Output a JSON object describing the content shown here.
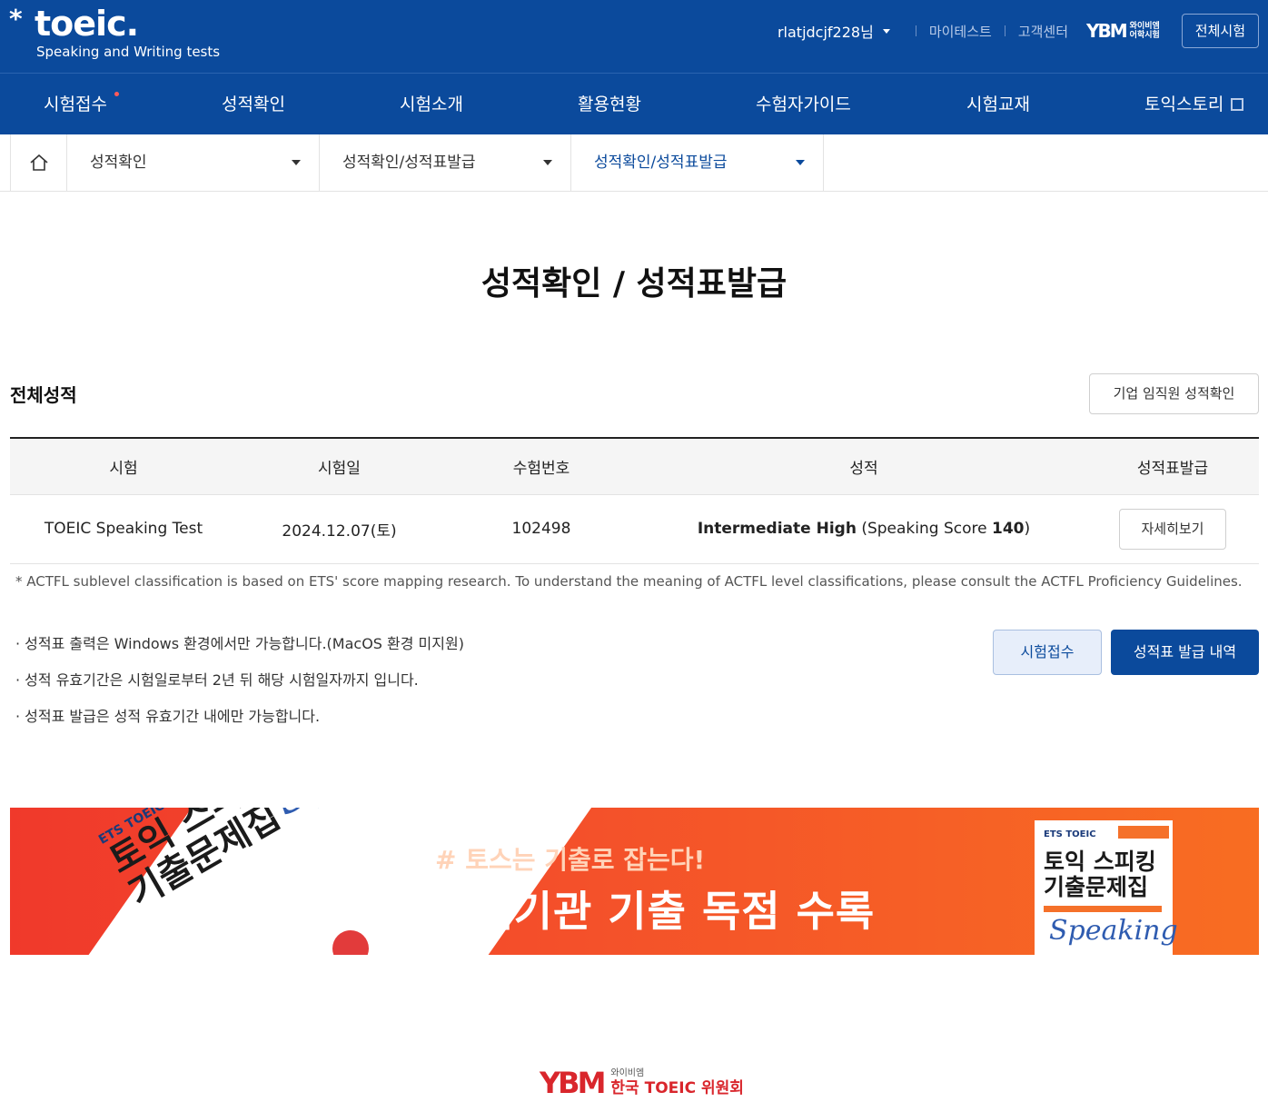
{
  "header": {
    "logo_main": "toeic.",
    "logo_sub": "Speaking and Writing tests",
    "user_name": "rlatjdcjf228님",
    "my_test": "마이테스트",
    "customer_center": "고객센터",
    "ybm_text_line1": "와이비엠",
    "ybm_text_line2": "어학시험",
    "all_tests": "전체시험"
  },
  "nav": {
    "items": [
      {
        "label": "시험접수"
      },
      {
        "label": "성적확인"
      },
      {
        "label": "시험소개"
      },
      {
        "label": "활용현황"
      },
      {
        "label": "수험자가이드"
      },
      {
        "label": "시험교재"
      },
      {
        "label": "토익스토리"
      }
    ]
  },
  "breadcrumb": {
    "level1": "성적확인",
    "level2": "성적확인/성적표발급",
    "level3": "성적확인/성적표발급"
  },
  "page": {
    "title": "성적확인 / 성적표발급",
    "section_title": "전체성적",
    "corp_button": "기업 임직원 성적확인"
  },
  "table": {
    "headers": [
      "시험",
      "시험일",
      "수험번호",
      "성적",
      "성적표발급"
    ],
    "rows": [
      {
        "test": "TOEIC Speaking Test",
        "date": "2024.12.07(토)",
        "number": "102498",
        "level": "Intermediate High",
        "score_prefix": "(Speaking Score ",
        "score": "140",
        "score_suffix": ")",
        "detail": "자세히보기"
      }
    ]
  },
  "footnote": "* ACTFL sublevel classification is based on ETS' score mapping research. To understand the meaning of ACTFL level classifications, please consult the ACTFL Proficiency Guidelines.",
  "notes": [
    "· 성적표 출력은 Windows 환경에서만 가능합니다.(MacOS 환경 미지원)",
    "· 성적 유효기간은 시험일로부터 2년 뒤 해당 시험일자까지 입니다.",
    "· 성적표 발급은 성적 유효기간 내에만 가능합니다."
  ],
  "actions": {
    "apply": "시험접수",
    "history": "성적표 발급 내역"
  },
  "banner": {
    "hash": "# 토스는 기출로 잡는다!",
    "main": "출제기관 기출 독점 수록",
    "book_brand": "ETS TOEIC",
    "book_title_line1": "토익 스피킹",
    "book_title_line2": "기출문제집",
    "book_script": "Speaking"
  },
  "footer": {
    "small": "와이비엠",
    "big": "한국 TOEIC 위원회"
  }
}
